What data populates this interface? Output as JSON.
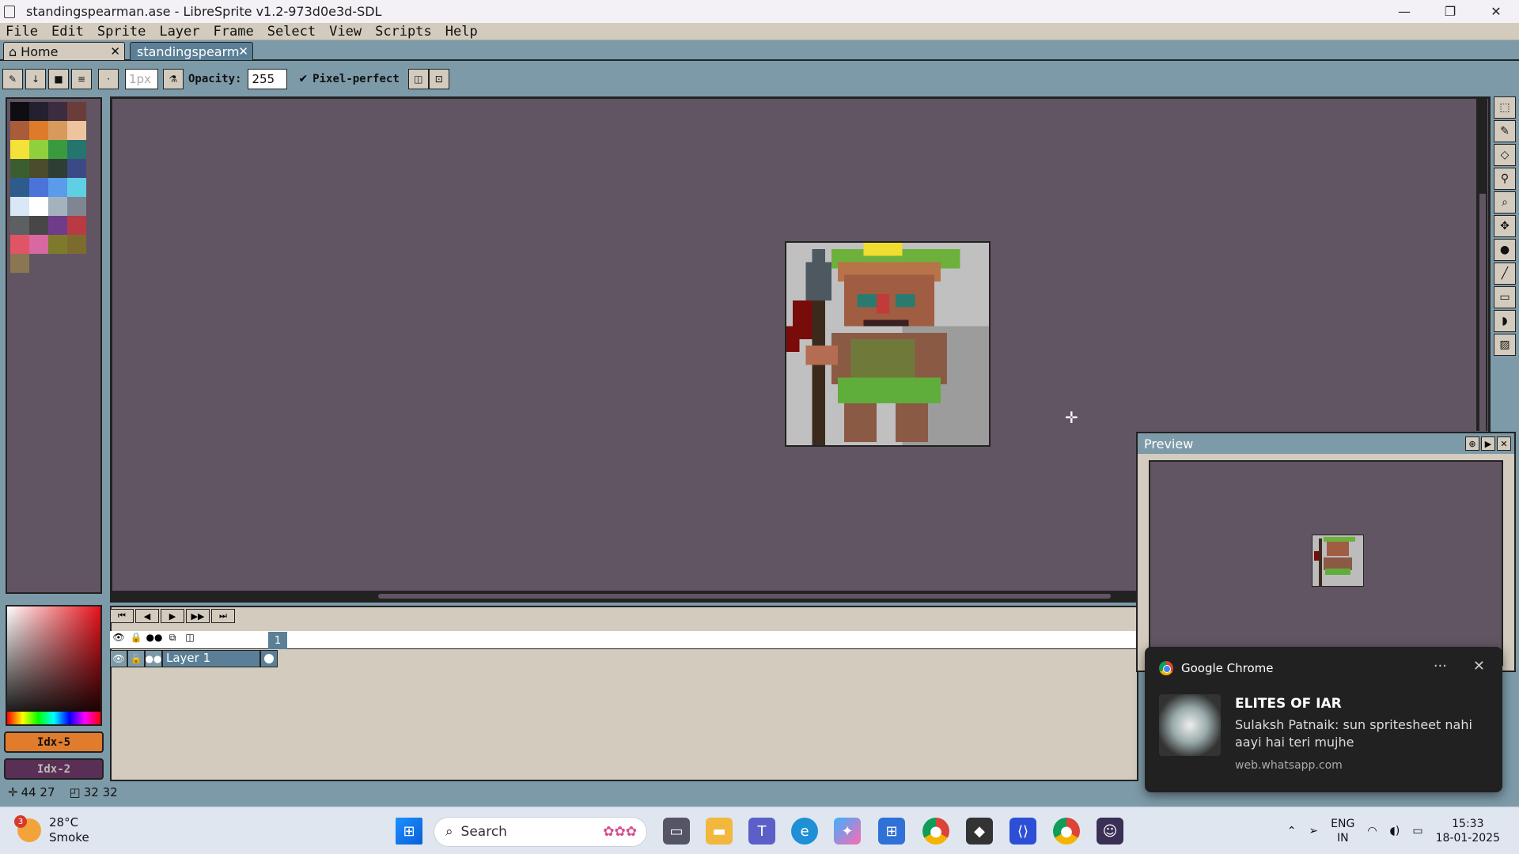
{
  "window": {
    "title": "standingspearman.ase - LibreSprite v1.2-973d0e3d-SDL",
    "minimize": "—",
    "maximize": "❐",
    "close": "✕"
  },
  "menu": [
    "File",
    "Edit",
    "Sprite",
    "Layer",
    "Frame",
    "Select",
    "View",
    "Scripts",
    "Help"
  ],
  "tabs": [
    {
      "label": "Home",
      "close": "✕"
    },
    {
      "label": "standingspearm",
      "close": "✕"
    }
  ],
  "toolbar": {
    "brush_size": "1px",
    "opacity_label": "Opacity:",
    "opacity_value": "255",
    "pixel_perfect_label": "Pixel-perfect",
    "pixel_perfect_checked": true
  },
  "palette": {
    "colors": [
      "#0e0d12",
      "#232030",
      "#3b2c3f",
      "#6a3c3a",
      "#a85c39",
      "#df7a2b",
      "#d89a5c",
      "#edc49d",
      "#f4e13a",
      "#8fd13c",
      "#3a9a3e",
      "#24756d",
      "#3a5e2f",
      "#4b4b2d",
      "#2f3e35",
      "#3b4a86",
      "#2d5b8c",
      "#4b73d8",
      "#5a9bea",
      "#5fd0e4",
      "#d9e7f7",
      "#ffffff",
      "#a4b2bd",
      "#7f8691",
      "#5d6063",
      "#494649",
      "#6e3c8b",
      "#b93a45",
      "#e15466",
      "#d768a2",
      "#7e7a2c",
      "#7b6c2e",
      "#8a7650"
    ]
  },
  "color_bar": {
    "fg_label": "Idx-5",
    "bg_label": "Idx-2",
    "fg_color": "#e07c2b",
    "bg_color": "#5a2f55"
  },
  "timeline": {
    "frame_number": "1",
    "layers": [
      {
        "name": "Layer 1"
      }
    ]
  },
  "status": {
    "cursor_pos": "44 27",
    "sprite_size": "32 32"
  },
  "preview": {
    "title": "Preview"
  },
  "notification": {
    "app": "Google Chrome",
    "more": "···",
    "close": "✕",
    "title": "ELITES OF IAR",
    "message": "Sulaksh Patnaik: sun spritesheet nahi aayi hai teri mujhe",
    "site": "web.whatsapp.com"
  },
  "taskbar": {
    "weather_badge": "3",
    "temperature": "28°C",
    "weather_desc": "Smoke",
    "search_placeholder": "Search",
    "lang": "ENG",
    "region": "IN",
    "time": "15:33",
    "date": "18-01-2025"
  }
}
